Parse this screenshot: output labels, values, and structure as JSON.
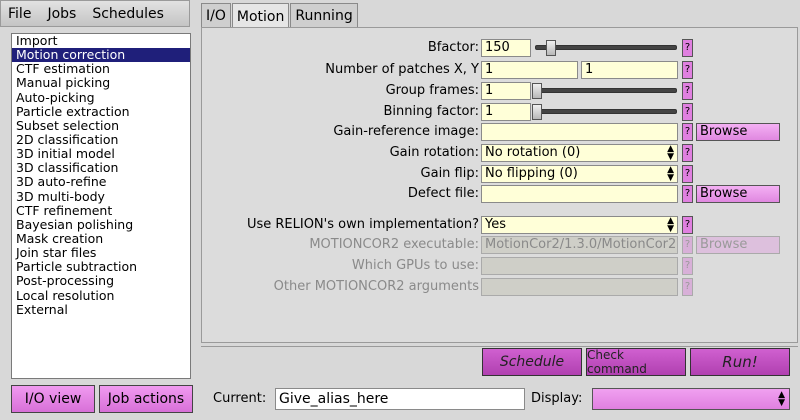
{
  "menu": [
    "File",
    "Jobs",
    "Schedules"
  ],
  "job_types": [
    "Import",
    "Motion correction",
    "CTF estimation",
    "Manual picking",
    "Auto-picking",
    "Particle extraction",
    "Subset selection",
    "2D classification",
    "3D initial model",
    "3D classification",
    "3D auto-refine",
    "3D multi-body",
    "CTF refinement",
    "Bayesian polishing",
    "Mask creation",
    "Join star files",
    "Particle subtraction",
    "Post-processing",
    "Local resolution",
    "External"
  ],
  "selected_job": "Motion correction",
  "tabs": [
    "I/O",
    "Motion",
    "Running"
  ],
  "active_tab": "Motion",
  "form": {
    "bfactor_label": "Bfactor:",
    "bfactor_value": "150",
    "bfactor_slider": 0.1,
    "patches_label": "Number of patches X, Y",
    "patches_x": "1",
    "patches_y": "1",
    "group_label": "Group frames:",
    "group_value": "1",
    "group_slider": 0.0,
    "binning_label": "Binning factor:",
    "binning_value": "1",
    "binning_slider": 0.0,
    "gainref_label": "Gain-reference image:",
    "gainref_value": "",
    "gainrot_label": "Gain rotation:",
    "gainrot_value": "No rotation (0)",
    "gainflip_label": "Gain flip:",
    "gainflip_value": "No flipping (0)",
    "defect_label": "Defect file:",
    "defect_value": "",
    "relion_label": "Use RELION's own implementation?",
    "relion_value": "Yes",
    "motioncor_label": "MOTIONCOR2 executable:",
    "motioncor_value": "MotionCor2/1.3.0/MotionCor2",
    "gpus_label": "Which GPUs to use:",
    "gpus_value": "",
    "other_label": "Other MOTIONCOR2 arguments",
    "other_value": ""
  },
  "help": "?",
  "browse": "Browse",
  "buttons": {
    "io_view": "I/O view",
    "job_actions": "Job actions",
    "schedule": "Schedule",
    "check": "Check command",
    "run": "Run!"
  },
  "current_label": "Current:",
  "current_value": "Give_alias_here",
  "display_label": "Display:",
  "display_value": ""
}
